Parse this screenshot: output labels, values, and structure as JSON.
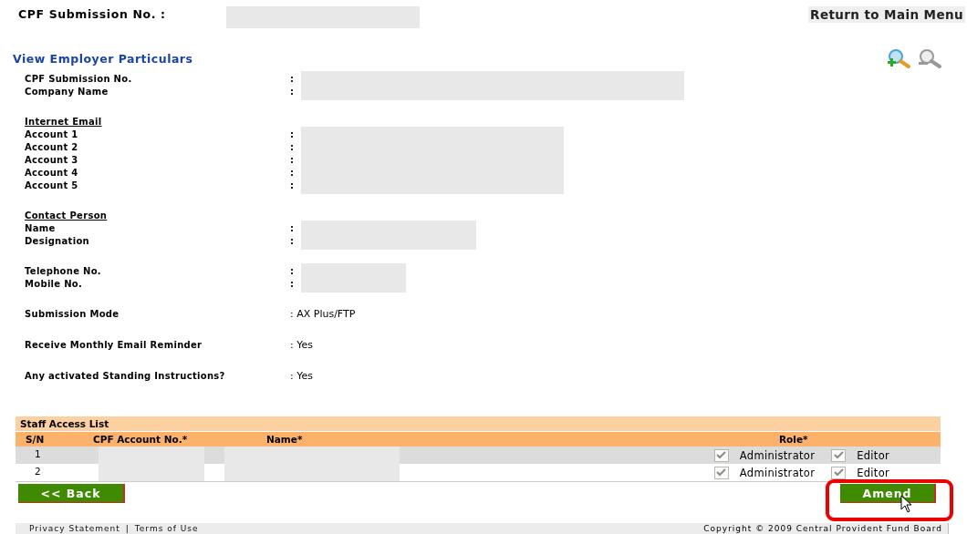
{
  "header": {
    "submission_label": "CPF Submission No. :",
    "return_link": "Return to Main Menu"
  },
  "section_title": "View Employer Particulars",
  "groups": [
    {
      "fields": [
        {
          "label": "CPF Submission No.",
          "value": ":"
        },
        {
          "label": "Company Name",
          "value": ":"
        }
      ]
    },
    {
      "heading": "Internet Email",
      "fields": [
        {
          "label": "Account 1",
          "value": ":"
        },
        {
          "label": "Account 2",
          "value": ":"
        },
        {
          "label": "Account 3",
          "value": ":"
        },
        {
          "label": "Account 4",
          "value": ":"
        },
        {
          "label": "Account 5",
          "value": ":"
        }
      ]
    },
    {
      "heading": "Contact Person",
      "fields": [
        {
          "label": "Name",
          "value": ":"
        },
        {
          "label": "Designation",
          "value": ":"
        }
      ]
    },
    {
      "fields": [
        {
          "label": "Telephone No.",
          "value": ":"
        },
        {
          "label": "Mobile No.",
          "value": ":"
        }
      ]
    },
    {
      "fields": [
        {
          "label": "Submission Mode",
          "value": ": AX Plus/FTP"
        }
      ]
    },
    {
      "fields": [
        {
          "label": "Receive Monthly Email Reminder",
          "value": ": Yes"
        }
      ]
    },
    {
      "fields": [
        {
          "label": "Any activated Standing Instructions?",
          "value": ": Yes"
        }
      ]
    }
  ],
  "staff_table": {
    "title": "Staff Access List",
    "columns": [
      "S/N",
      "CPF Account No.*",
      "Name*",
      "Role*"
    ],
    "rows": [
      {
        "sn": "1",
        "roles": [
          {
            "label": "Administrator",
            "checked": true,
            "disabled": true
          },
          {
            "label": "Editor",
            "checked": true,
            "disabled": true
          }
        ]
      },
      {
        "sn": "2",
        "roles": [
          {
            "label": "Administrator",
            "checked": true,
            "disabled": true
          },
          {
            "label": "Editor",
            "checked": true,
            "disabled": true
          }
        ]
      }
    ]
  },
  "buttons": {
    "back": "<< Back",
    "amend": "Amend",
    "amend_highlighted": true
  },
  "footer": {
    "links": [
      "Privacy Statement",
      "Terms of Use"
    ],
    "separator": "|",
    "copyright": "Copyright © 2009 Central Provident Fund  Board"
  }
}
